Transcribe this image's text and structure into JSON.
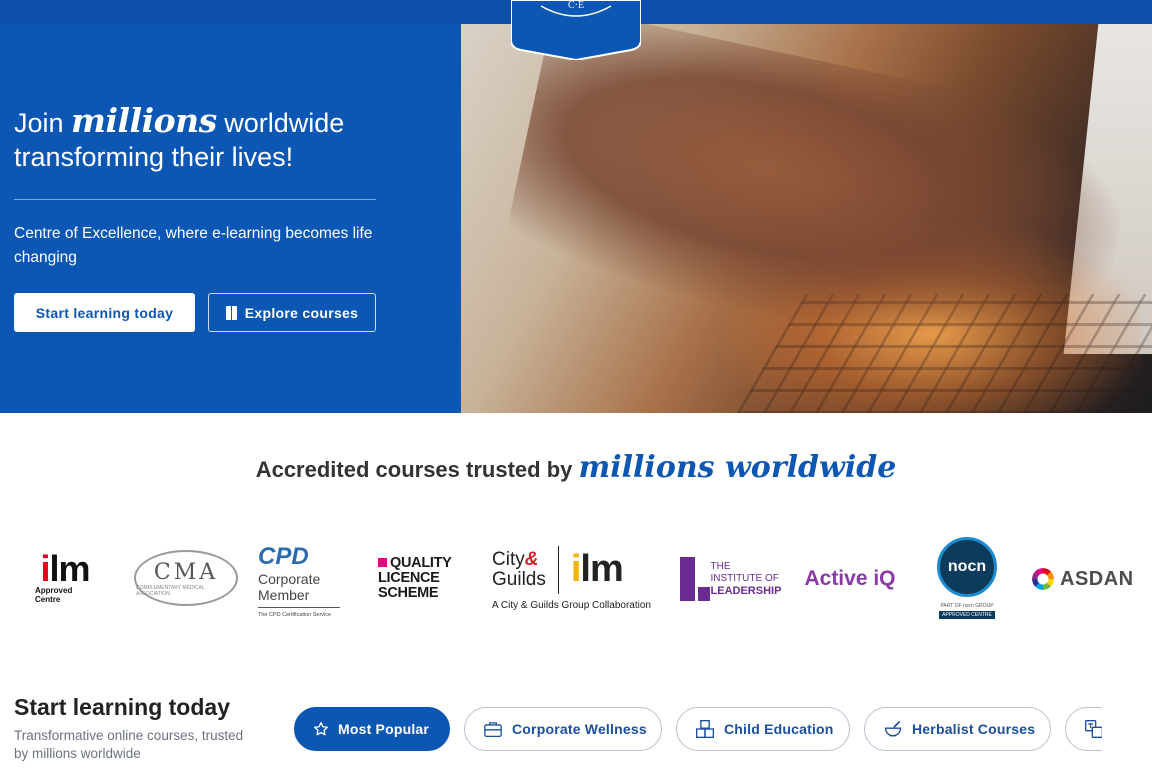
{
  "brand": {
    "crest_initials": "C·E",
    "colors": {
      "primary": "#0b57b3",
      "topbar": "#0b4fa8",
      "white": "#ffffff",
      "tab_text": "#1a4f9c"
    }
  },
  "hero": {
    "title_prefix": "Join",
    "title_script": "millions",
    "title_suffix": "worldwide",
    "title_line2": "transforming their lives!",
    "subtitle": "Centre of Excellence, where e-learning becomes life changing",
    "cta_primary": "Start learning today",
    "cta_secondary": "Explore courses",
    "cta_secondary_icon": "book-icon"
  },
  "accredited": {
    "heading_prefix": "Accredited courses trusted by",
    "heading_script": "millions worldwide",
    "logos": {
      "ilm": {
        "word_i": "i",
        "word_rest": "lm",
        "caption_1": "Approved",
        "caption_2": "Centre"
      },
      "cma": {
        "word": "CMA",
        "tiny": "COMPLEMENTARY MEDICAL ASSOCIATION"
      },
      "cpd": {
        "word": "CPD",
        "line1": "Corporate",
        "line2": "Member",
        "tiny": "The CPD Certification Service"
      },
      "qls": {
        "line1": "QUALITY",
        "line2": "LICENCE",
        "line3": "SCHEME"
      },
      "city_guilds": {
        "city": "City",
        "amp": "&",
        "guilds": "Guilds",
        "ilm_i": "i",
        "ilm_rest": "lm",
        "caption": "A City & Guilds Group Collaboration"
      },
      "iol": {
        "line1": "THE INSTITUTE OF",
        "line2": "LEADERSHIP"
      },
      "active_iq": {
        "word": "Active iQ"
      },
      "nocn": {
        "word": "nocn",
        "tiny": "PART OF nocn GROUP",
        "badge": "APPROVED CENTRE"
      },
      "asdan": {
        "word": "ASDAN"
      }
    }
  },
  "start_learning": {
    "title": "Start learning today",
    "subtitle": "Transformative online courses, trusted by millions worldwide",
    "tabs": [
      {
        "label": "Most Popular",
        "icon": "star-icon",
        "active": true
      },
      {
        "label": "Corporate Wellness",
        "icon": "briefcase-icon",
        "active": false
      },
      {
        "label": "Child Education",
        "icon": "blocks-icon",
        "active": false
      },
      {
        "label": "Herbalist Courses",
        "icon": "mortar-pestle-icon",
        "active": false
      },
      {
        "label": "",
        "icon": "translate-icon",
        "active": false
      }
    ]
  }
}
